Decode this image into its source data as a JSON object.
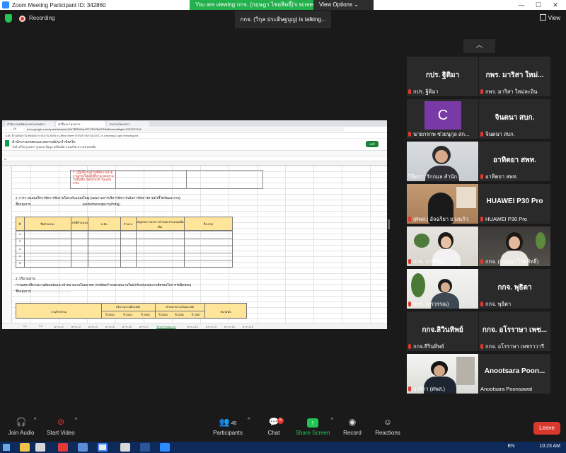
{
  "window": {
    "title": "Zoom Meeting Participant ID: 342860",
    "minimize": "—",
    "maximize": "☐",
    "close": "✕"
  },
  "share_banner": {
    "text": "You are viewing กกจ. (กฤษฎา ไชยสิทธิ์)'s screen",
    "view_options": "View Options ⌄"
  },
  "status": {
    "recording": "Recording",
    "talking": "กกจ. (วิกุล ประดิษฐบุญ) is  talking...",
    "view": "View"
  },
  "shared_screen": {
    "tabs": [
      "สำนักงานปลัดกระทรวงเกษตรฯ",
      "คำชี้แจง โครงการ...",
      "รายงานโครงการ"
    ],
    "url": "docs.google.com/spreadsheets/d/1dTBRM0aHiSTURVSbUPNbMIxw/edit#gid=1022297118",
    "bookmarks": "แอป  ตำแหน่งงาน  ทดสอบ  ระบบงาน  KMS  e-Office  Meet  ระบบสารบรรณ  DOC  e-Learning  Login  Reading list",
    "doc_title": "สำนักงานเกษตรและสหกรณ์ประจำจังหวัด",
    "menu": "ไฟล์  แก้ไข  ดู  แทรก  รูปแบบ  ข้อมูล  เครื่องมือ  ส่วนเสริม  ความช่วยเหลือ",
    "share_button": "แชร์",
    "fx": "fx",
    "red_note": "7. ปฏิบัติงานด้านที่ต้อง หน่วยงานภายในปฏิบัติงาน ของงานในพื้นที่มาช่องกันได้ ในแผนงาน",
    "section2": "2. การวางแผนบริหารจัดการทีมงานในระดับแปลงใหญ่ (แผนงานการบริหารจัดการ/เน้นการจัดการตามตัวชี้วัด/พัฒนางาน)",
    "group_label": "ชื่อกลุ่มงาน ........................................................  (ผลลัพธ์ของกลุ่มงานสำคัญ)",
    "table_headers": [
      "ที่",
      "ชื่อตำแหน่ง",
      "เลขที่ตำแหน่ง",
      "ระดับ",
      "จำนวน",
      "เหตุผลประกอบการกำหนด ตำแหน่งเพิ่มเติม",
      "ชื่อ-สกุล"
    ],
    "row_numbers": [
      "1",
      "2",
      "3",
      "4",
      "5"
    ],
    "section3": "3. ปริมาณงาน",
    "section3_desc": "การแสดงปริมาณงานย้อนหลังและเป้าหมายงานในอนาคต (กรณีขอกำหนดกลุ่มงานใหม่/ปรับปรุงกลุ่มงานที่ครอบในการรับผิดชอบ)",
    "group_label2": "ชื่อกลุ่มงาน ............................................",
    "t2_task": "งาน/กิจกรรม",
    "t2_past": "ปริมาณงานย้อนหลัง",
    "t2_future": "เป้าหมายงานในอนาคต",
    "t2_unit": "หน่วยนับ",
    "t2_years": [
      "ปี 2562",
      "ปี 2563",
      "ปี 2564",
      "ปี 2565",
      "ปี 2566",
      "ปี 2567"
    ],
    "sheet_tabs": [
      "1.1",
      "1.2",
      "ตาราง 2",
      "ตาราง 3",
      "ตาราง 4",
      "ตาราง 5",
      "ตาราง 6",
      "ตาราง 7",
      "ตาราง 8",
      "ตาราง 9",
      "ตาราง 10",
      "โครงการ/แผนงาน",
      "ตาราง 12",
      "ตาราง 13",
      "ตาราง 14",
      "ตาราง 15"
    ]
  },
  "gallery": {
    "scroll_up": "︿",
    "tiles": [
      {
        "big": "กปร. ฐิติมา",
        "name": "กปร. ฐิติมา"
      },
      {
        "big": "กพร. มาริสา ใหม่...",
        "name": "กพร. มาริสา ใหม่ละอิน"
      },
      {
        "avatar": "C",
        "name": "นายกรกพ  ช่วยนุกุล สก..."
      },
      {
        "big": "จินตนา สบก.",
        "name": "จินตนา สบก."
      },
      {
        "name": "วิจิตรา: รักกมล สำนัก..."
      },
      {
        "big": "อาทิตยา สพท.",
        "name": "อาทิตยา สพท."
      },
      {
        "name": "(ศพส.) อัจฉริยา ยวงแก้ว"
      },
      {
        "big": "HUAWEI P30 Pro",
        "name": "HUAWEI P30 Pro"
      },
      {
        "name": "กกจ. การีรัตน์"
      },
      {
        "name": "กกจ. (กฤษฎา ไชยสิทธิ์)"
      },
      {
        "name": "กพร. (กรวรรณ)"
      },
      {
        "big": "กกจ. พุธิตา",
        "name": "กกจ. พุธิตา"
      },
      {
        "big": "กกจ.ลิวินทิพย์",
        "name": "กกจ.ธีรินทิพย์"
      },
      {
        "big": "กกจ. อโรราษา เพช...",
        "name": "กกจ. อโรราษา เพชราวารี"
      },
      {
        "name": "อาริกา (ศพส.)"
      },
      {
        "big": "Anootsara  Poon...",
        "name": "Anootsara Poonsawat"
      }
    ]
  },
  "controls": {
    "join_audio": "Join Audio",
    "start_video": "Start Video",
    "participants": "Participants",
    "participants_count": "40",
    "chat": "Chat",
    "chat_badge": "6",
    "share_screen": "Share Screen",
    "record": "Record",
    "reactions": "Reactions",
    "leave": "Leave",
    "caret": "^"
  },
  "taskbar": {
    "lang": "EN",
    "time": "10:23 AM"
  },
  "colors": {
    "zoom_green": "#23c552",
    "leave_red": "#d9382d",
    "sheet_header_yellow": "#ffe599",
    "gallery_tile": "#2a2a2a"
  }
}
